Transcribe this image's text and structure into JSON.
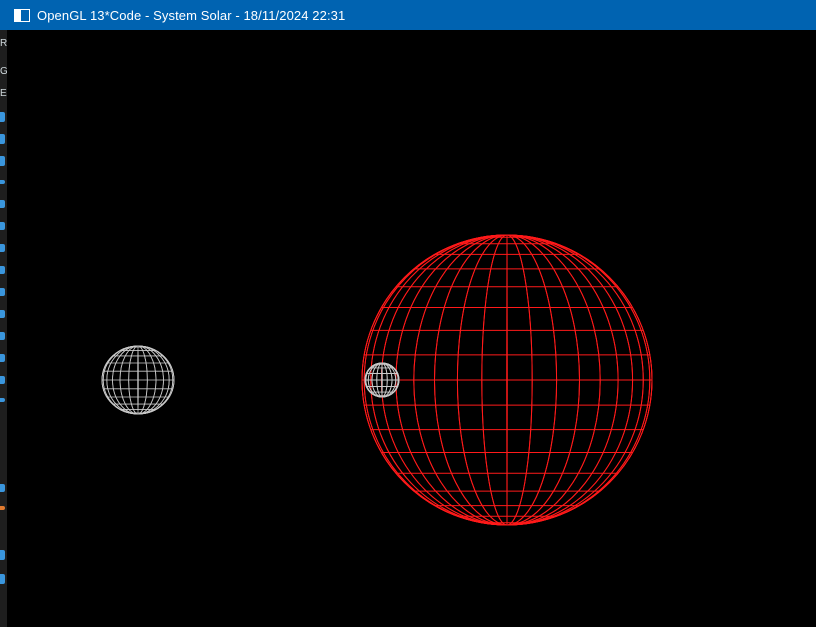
{
  "window": {
    "title": "OpenGL 13*Code - System Solar - 18/11/2024 22:31"
  },
  "icons": {
    "app": "window-icon"
  },
  "colors": {
    "titlebar": "#0063b1",
    "background": "#000000",
    "sun_wire": "#ff1a1a",
    "planet_wire": "#c8c8c8"
  },
  "background_strip": {
    "letters": [
      "R",
      "G",
      "E"
    ]
  },
  "scene": {
    "bodies": [
      {
        "name": "sun",
        "wireframe": true,
        "color": "#ff1a1a"
      },
      {
        "name": "planet",
        "wireframe": true,
        "color": "#c8c8c8"
      },
      {
        "name": "moon",
        "wireframe": true,
        "color": "#c8c8c8"
      }
    ]
  }
}
